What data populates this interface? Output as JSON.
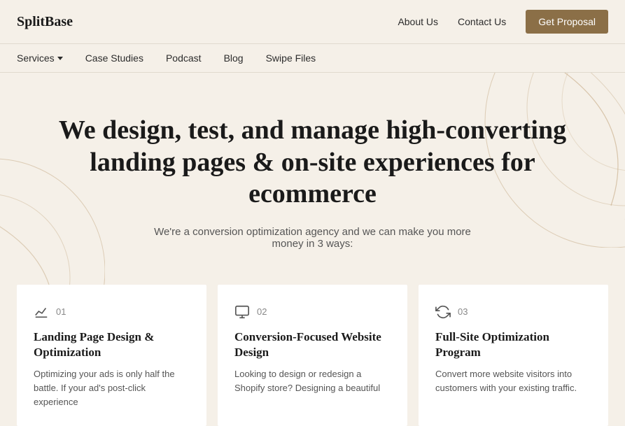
{
  "logo": "SplitBase",
  "header": {
    "nav": [
      {
        "label": "About Us",
        "id": "about-us"
      },
      {
        "label": "Contact Us",
        "id": "contact-us"
      }
    ],
    "cta": "Get Proposal"
  },
  "main_nav": [
    {
      "label": "Services",
      "id": "services",
      "has_dropdown": true
    },
    {
      "label": "Case Studies",
      "id": "case-studies"
    },
    {
      "label": "Podcast",
      "id": "podcast"
    },
    {
      "label": "Blog",
      "id": "blog"
    },
    {
      "label": "Swipe Files",
      "id": "swipe-files"
    }
  ],
  "hero": {
    "headline": "We design, test, and manage high-converting landing pages & on-site experiences for ecommerce",
    "subtext": "We're a conversion optimization agency and we can make you more money in 3 ways:"
  },
  "cards": [
    {
      "number": "01",
      "icon": "chart-icon",
      "title": "Landing Page Design & Optimization",
      "description": "Optimizing your ads is only half the battle. If your ad's post-click experience"
    },
    {
      "number": "02",
      "icon": "monitor-icon",
      "title": "Conversion-Focused Website Design",
      "description": "Looking to design or redesign a Shopify store? Designing a beautiful"
    },
    {
      "number": "03",
      "icon": "refresh-icon",
      "title": "Full-Site Optimization Program",
      "description": "Convert more website visitors into customers with your existing traffic."
    }
  ]
}
